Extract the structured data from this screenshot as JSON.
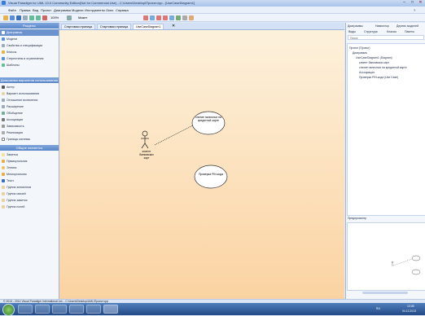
{
  "window": {
    "title": "Visual Paradigm for UML 10.0 Community Edition(Not for Commercial Use) - C:\\Users\\Desktop\\Проект.vpp - [UseCaseDiagram1]"
  },
  "menu": [
    "Файл",
    "Правка",
    "Вид",
    "Проект",
    "Диаграмма",
    "Модели",
    "Инструменты",
    "Окно",
    "Справка"
  ],
  "toolbar": {
    "zoom": "100%",
    "layout_label": "Макет"
  },
  "left_panel": {
    "top_header": "Разделы",
    "top_items": [
      {
        "label": "Диаграммы",
        "selected": true
      },
      {
        "label": "Модели",
        "selected": false
      },
      {
        "label": "Свойства и спецификации",
        "selected": false
      },
      {
        "label": "Классы",
        "selected": false
      },
      {
        "label": "Стереотипы и ограничения",
        "selected": false
      },
      {
        "label": "Шаблоны",
        "selected": false
      }
    ],
    "mid_header": "Диаграмма вариантов использования",
    "mid_items": [
      {
        "label": "Актер"
      },
      {
        "label": "Вариант использования"
      },
      {
        "label": "Отношение включения"
      },
      {
        "label": "Расширение"
      },
      {
        "label": "Обобщение"
      },
      {
        "label": "Ассоциация"
      },
      {
        "label": "Зависимость"
      },
      {
        "label": "Реализация"
      },
      {
        "label": "Граница системы"
      }
    ],
    "bottom_header": "Общие элементы",
    "bottom_items": [
      {
        "label": "Заметка"
      },
      {
        "label": "Прямоугольник"
      },
      {
        "label": "Эллипс"
      },
      {
        "label": "Многоугольник"
      },
      {
        "label": "Текст"
      },
      {
        "label": "Группа элементов"
      },
      {
        "label": "Группа связей"
      },
      {
        "label": "Группа заметок"
      },
      {
        "label": "Группа полей"
      }
    ]
  },
  "tabs": [
    {
      "label": "Стартовая страница",
      "active": false
    },
    {
      "label": "Стартовая страница",
      "active": false
    },
    {
      "label": "UseCaseDiagram1",
      "active": true
    }
  ],
  "diagram": {
    "actor_label": "клиент банковских карт",
    "usecase1_label": "снятие наличных на кредитной карте",
    "usecase2_label": "Проверка PIN-кода"
  },
  "right_panel": {
    "tabs": [
      "Диаграммы",
      "Навигатор",
      "Дерево моделей"
    ],
    "sub_tabs": [
      "Виды",
      "Структура",
      "Классы",
      "Пакеты"
    ],
    "search_placeholder": "Поиск",
    "tree_items": [
      "Проект (Проект)",
      "Диаграмма",
      "UseCaseDiagram1 (Diagram)",
      "клиент банковских карт",
      "снятие наличных на кредитной карте",
      "Ассоциация",
      "Проверка PIN-кода (Use Case)"
    ],
    "preview_label": "Предпросмотр",
    "zoom_label": "—"
  },
  "statusbar": {
    "text": "© 2013 - 2014 Visual Paradigm International Ltd. - C:\\Users\\Desktop\\UML\\Проект.vpp"
  },
  "taskbar": {
    "lang": "RU",
    "time": "13:08",
    "date": "04.12.2013"
  }
}
